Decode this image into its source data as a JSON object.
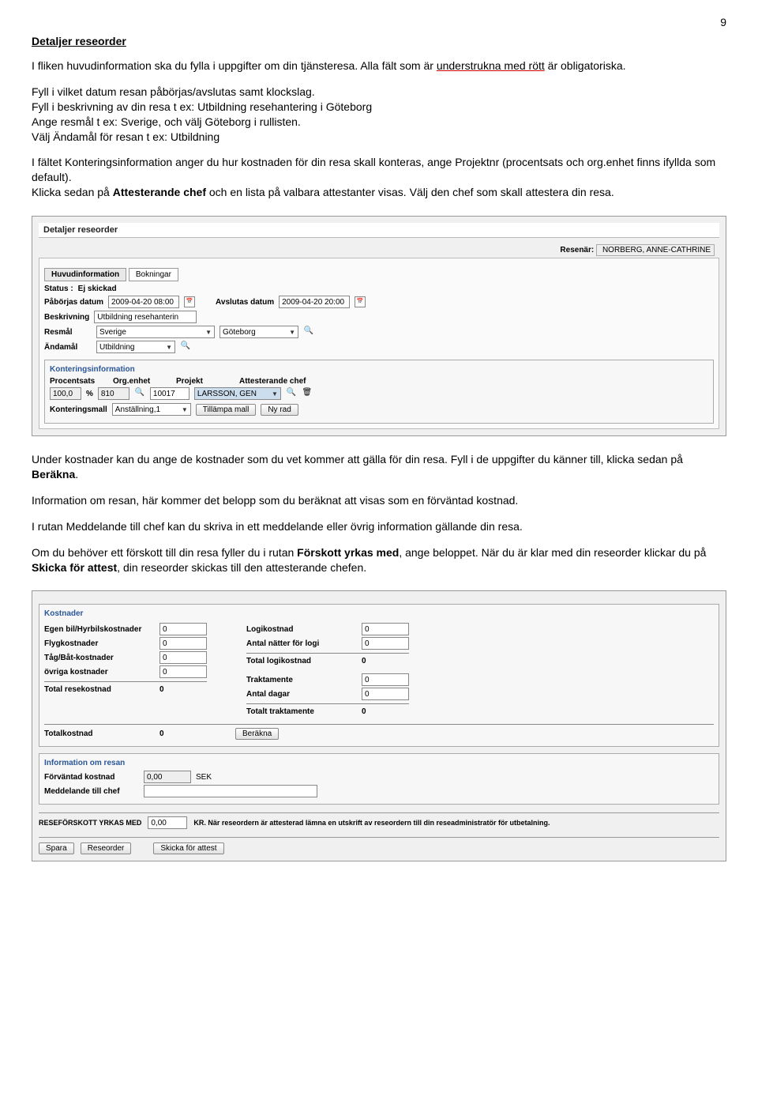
{
  "page_number": "9",
  "title": "Detaljer reseorder",
  "paragraphs": {
    "p1a": "I fliken huvudinformation ska du fylla i uppgifter om din tjänsteresa. Alla fält som är ",
    "p1b": "understrukna med rött",
    "p1c": " är obligatoriska.",
    "p2": "Fyll i vilket datum resan påbörjas/avslutas samt klockslag.",
    "p3": "Fyll i beskrivning av din resa t ex: Utbildning resehantering i Göteborg",
    "p4": "Ange resmål t ex: Sverige, och välj Göteborg i rullisten.",
    "p5": "Välj Ändamål för resan t ex: Utbildning",
    "p6": "I fältet Konteringsinformation anger du hur kostnaden för din resa skall konteras, ange Projektnr (procentsats och org.enhet finns ifyllda som default).",
    "p7a": "Klicka sedan på ",
    "p7b": "Attesterande chef",
    "p7c": " och en lista på valbara attestanter visas. Välj den chef som skall attestera din resa.",
    "p8a": "Under kostnader kan du ange de kostnader som du vet kommer att gälla för din resa. Fyll i de uppgifter du känner till, klicka sedan på ",
    "p8b": "Beräkna",
    "p8c": ".",
    "p9": "Information om resan, här kommer det belopp som du beräknat att visas som en förväntad kostnad.",
    "p10": "I rutan Meddelande till chef kan du skriva in ett meddelande eller övrig information gällande din resa.",
    "p11a": "Om du behöver ett förskott till din resa fyller du i rutan ",
    "p11b": "Förskott yrkas med",
    "p11c": ", ange beloppet. När du är klar med din reseorder klickar du på ",
    "p11d": "Skicka för attest",
    "p11e": ", din reseorder skickas till den attesterande chefen."
  },
  "screenshot1": {
    "panel_title": "Detaljer reseorder",
    "resenar_label": "Resenär:",
    "resenar_value": "NORBERG, ANNE-CATHRINE",
    "tab1": "Huvudinformation",
    "tab2": "Bokningar",
    "status_label": "Status :",
    "status_value": "Ej skickad",
    "start_label": "Påbörjas datum",
    "start_value": "2009-04-20 08:00",
    "end_label": "Avslutas datum",
    "end_value": "2009-04-20 20:00",
    "beskrivning_label": "Beskrivning",
    "beskrivning_value": "Utbildning resehanterin",
    "resmal_label": "Resmål",
    "resmal_country": "Sverige",
    "resmal_city": "Göteborg",
    "andamal_label": "Ändamål",
    "andamal_value": "Utbildning",
    "kontering_title": "Konteringsinformation",
    "kh_procent": "Procentsats",
    "kh_org": "Org.enhet",
    "kh_projekt": "Projekt",
    "kh_chef": "Attesterande chef",
    "kv_procent": "100,0",
    "kv_pct": "%",
    "kv_org": "810",
    "kv_projekt": "10017",
    "kv_chef": "LARSSON, GEN",
    "mall_label": "Konteringsmall",
    "mall_value": "Anställning,1",
    "btn_tillampa": "Tillämpa mall",
    "btn_nyrad": "Ny rad"
  },
  "screenshot2": {
    "kostnader_title": "Kostnader",
    "egen_label": "Egen bil/Hyrbilskostnader",
    "egen_val": "0",
    "flyg_label": "Flygkostnader",
    "flyg_val": "0",
    "tag_label": "Tåg/Båt-kostnader",
    "tag_val": "0",
    "ovriga_label": "övriga kostnader",
    "ovriga_val": "0",
    "total_rese_label": "Total resekostnad",
    "total_rese_val": "0",
    "logi_label": "Logikostnad",
    "logi_val": "0",
    "natter_label": "Antal nätter för logi",
    "natter_val": "0",
    "total_logi_label": "Total logikostnad",
    "total_logi_val": "0",
    "trakt_label": "Traktamente",
    "trakt_val": "0",
    "dagar_label": "Antal dagar",
    "dagar_val": "0",
    "total_trakt_label": "Totalt traktamente",
    "total_trakt_val": "0",
    "totalkostnad_label": "Totalkostnad",
    "totalkostnad_val": "0",
    "berakna_btn": "Beräkna",
    "info_title": "Information om resan",
    "forvantad_label": "Förväntad kostnad",
    "forvantad_val": "0,00",
    "sek": "SEK",
    "medd_label": "Meddelande till chef",
    "forskott_label": "RESEFÖRSKOTT YRKAS MED",
    "forskott_val": "0,00",
    "forskott_note": "KR. När reseordern är attesterad lämna en utskrift av reseordern till din reseadministratör för utbetalning.",
    "btn_spara": "Spara",
    "btn_reseorder": "Reseorder",
    "btn_skicka": "Skicka för attest"
  }
}
